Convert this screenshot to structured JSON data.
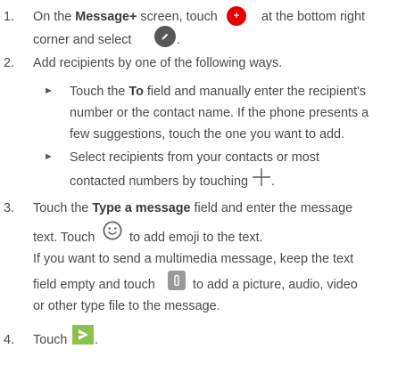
{
  "steps": [
    {
      "num": "1.",
      "line1_pre": "On the ",
      "line1_bold": "Message+",
      "line1_mid": " screen, touch",
      "line1_post": "at the bottom right",
      "line2_pre": "corner and select",
      "line2_post": "."
    },
    {
      "num": "2.",
      "line1": "Add recipients by one of the following ways.",
      "bullets": [
        {
          "symbol": "►",
          "l1_pre": "Touch the ",
          "l1_bold": "To",
          "l1_post": " field and manually enter the recipient's",
          "l2": "number or the contact name. If the phone presents a",
          "l3": "few suggestions, touch the one you want to add."
        },
        {
          "symbol": "►",
          "l1": "Select recipients from your contacts or most",
          "l2_pre": "contacted numbers by touching",
          "l2_post": "."
        }
      ]
    },
    {
      "num": "3.",
      "l1_pre": "Touch the ",
      "l1_bold": "Type a message",
      "l1_post": " field and enter the message",
      "l2_pre": "text. Touch",
      "l2_post": "to add emoji to the text.",
      "l3": "If you want to send a multimedia message, keep the text",
      "l4_pre": "field empty and touch",
      "l4_post": "to add a picture, audio, video",
      "l5": "or other type file to the message."
    },
    {
      "num": "4.",
      "l1_pre": "Touch",
      "l1_post": "."
    }
  ],
  "icons": {
    "add": {
      "name": "add-icon",
      "color": "#e60000",
      "glyph": "+"
    },
    "compose": {
      "name": "pencil-icon",
      "color": "#585858"
    },
    "plus": {
      "name": "plus-icon",
      "color": "#555555"
    },
    "emoji": {
      "name": "emoji-icon",
      "color": "#666666"
    },
    "attach": {
      "name": "paperclip-icon",
      "color": "#9a9a9a"
    },
    "send": {
      "name": "send-icon",
      "color": "#8bc34a"
    }
  }
}
